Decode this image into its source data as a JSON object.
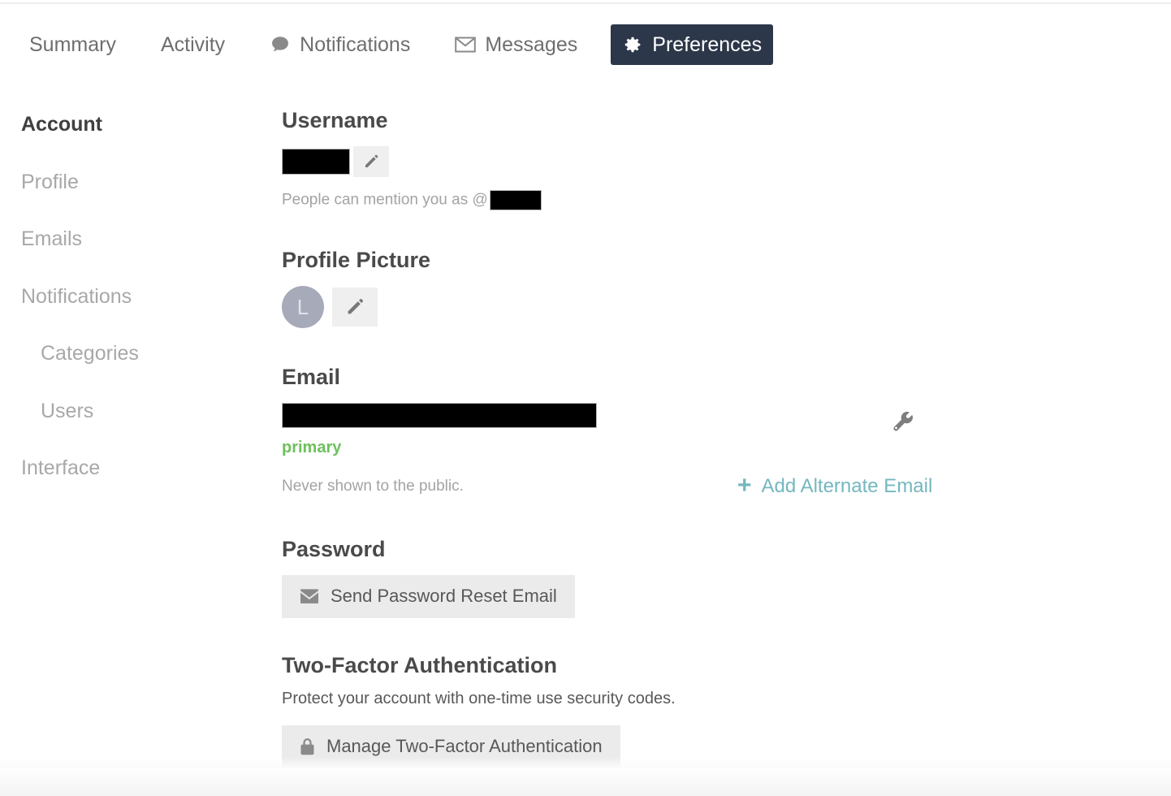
{
  "tabs": [
    {
      "label": "Summary",
      "icon": "none",
      "active": false
    },
    {
      "label": "Activity",
      "icon": "none",
      "active": false
    },
    {
      "label": "Notifications",
      "icon": "speech-bubble-icon",
      "active": false
    },
    {
      "label": "Messages",
      "icon": "envelope-icon",
      "active": false
    },
    {
      "label": "Preferences",
      "icon": "gear-icon",
      "active": true
    }
  ],
  "sidebar": {
    "items": [
      {
        "label": "Account",
        "active": true,
        "sub": false
      },
      {
        "label": "Profile",
        "active": false,
        "sub": false
      },
      {
        "label": "Emails",
        "active": false,
        "sub": false
      },
      {
        "label": "Notifications",
        "active": false,
        "sub": false
      },
      {
        "label": "Categories",
        "active": false,
        "sub": true
      },
      {
        "label": "Users",
        "active": false,
        "sub": true
      },
      {
        "label": "Interface",
        "active": false,
        "sub": false
      }
    ]
  },
  "username_section": {
    "title": "Username",
    "value": "",
    "redacted": true,
    "edit_icon": "pencil-icon",
    "mention_prefix": "People can mention you as @",
    "mention_value": "",
    "mention_redacted": true
  },
  "profile_picture_section": {
    "title": "Profile Picture",
    "avatar_initial": "L",
    "avatar_color": "#a7aab9",
    "edit_icon": "pencil-icon"
  },
  "email_section": {
    "title": "Email",
    "value": "",
    "redacted": true,
    "status_label": "primary",
    "status_color": "#6ec05c",
    "helper": "Never shown to the public.",
    "settings_icon": "wrench-icon",
    "add_alternate_label": "Add Alternate Email",
    "add_alternate_plus": "+",
    "link_color": "#74b7bf"
  },
  "password_section": {
    "title": "Password",
    "button_label": "Send Password Reset Email",
    "button_icon": "envelope-icon"
  },
  "two_factor_section": {
    "title": "Two-Factor Authentication",
    "description": "Protect your account with one-time use security codes.",
    "button_label": "Manage Two-Factor Authentication",
    "button_icon": "lock-icon"
  },
  "theme": {
    "active_tab_bg": "#2c3749",
    "button_bg": "#ebebeb",
    "muted_text": "#a8a8a8",
    "heading_text": "#4a4a4a"
  }
}
